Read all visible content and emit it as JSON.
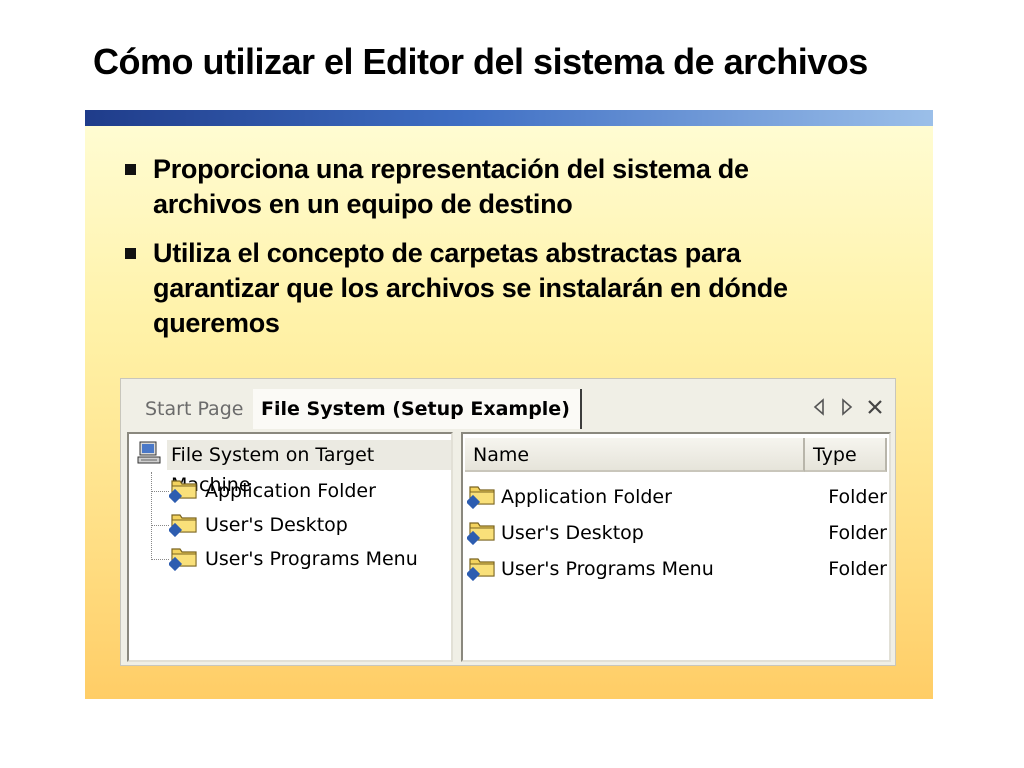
{
  "slide": {
    "title": "Cómo utilizar el Editor del sistema de archivos",
    "bullets": [
      "Proporciona una representación del sistema de archivos en un equipo de destino",
      "Utiliza el concepto de carpetas abstractas para garantizar que los archivos se instalarán en dónde queremos"
    ]
  },
  "screenshot": {
    "tabs": {
      "start_page": "Start Page",
      "file_system": "File System (Setup Example)"
    },
    "controls": {
      "prev_icon": "chevron-left-icon",
      "next_icon": "chevron-right-icon",
      "close_icon": "close-icon"
    },
    "tree": {
      "root": "File System on Target Machine",
      "items": [
        "Application Folder",
        "User's Desktop",
        "User's Programs Menu"
      ]
    },
    "list": {
      "columns": {
        "name": "Name",
        "type": "Type"
      },
      "rows": [
        {
          "name": "Application Folder",
          "type": "Folder"
        },
        {
          "name": "User's Desktop",
          "type": "Folder"
        },
        {
          "name": "User's Programs Menu",
          "type": "Folder"
        }
      ]
    }
  },
  "colors": {
    "title_bar_dark": "#1f3c8a",
    "title_bar_light": "#9bbfe9",
    "panel_top": "#fffcd2",
    "panel_bottom": "#ffcd66"
  }
}
